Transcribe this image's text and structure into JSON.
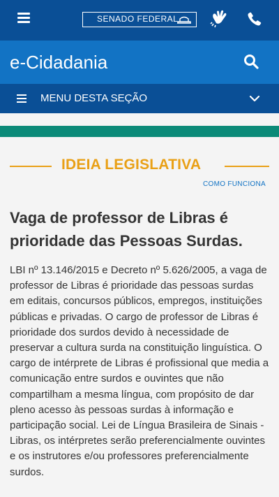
{
  "header": {
    "logo_text": "SENADO FEDERAL",
    "icons": [
      "menu-icon",
      "libras-icon",
      "phone-icon"
    ]
  },
  "portal": {
    "title": "e-Cidadania",
    "icon": "search-icon"
  },
  "section_menu": {
    "label": "MENU DESTA SEÇÃO",
    "icon": "chevron-down-icon"
  },
  "section": {
    "title": "IDEIA LEGISLATIVA",
    "help_link": "COMO FUNCIONA"
  },
  "idea": {
    "title": "Vaga de professor de Libras é prioridade das Pessoas Surdas.",
    "body": "LBI nº 13.146/2015 e Decreto nº 5.626/2005, a vaga de professor de Libras é prioridade das pessoas surdas em editais, concursos públicos, empregos, instituições públicas e privadas. O cargo de professor de Libras é prioridade dos surdos devido à necessidade de preservar a cultura surda na constituição linguística. O cargo de intérprete de Libras é profissional que media a comunicação entre surdos e ouvintes que não compartilham a mesma língua, com propósito de dar pleno acesso às pessoas surdas à informação e participação social. Lei de Língua Brasileira de Sinais - Libras, os intérpretes serão preferencialmente ouvintes e os instrutores e/ou professores preferencialmente surdos."
  },
  "colors": {
    "header_dark_blue": "#0a4f96",
    "header_blue": "#1273c4",
    "accent_green": "#0b8a78",
    "accent_orange": "#e9a016",
    "text": "#333333",
    "background": "#f4f4f4"
  }
}
